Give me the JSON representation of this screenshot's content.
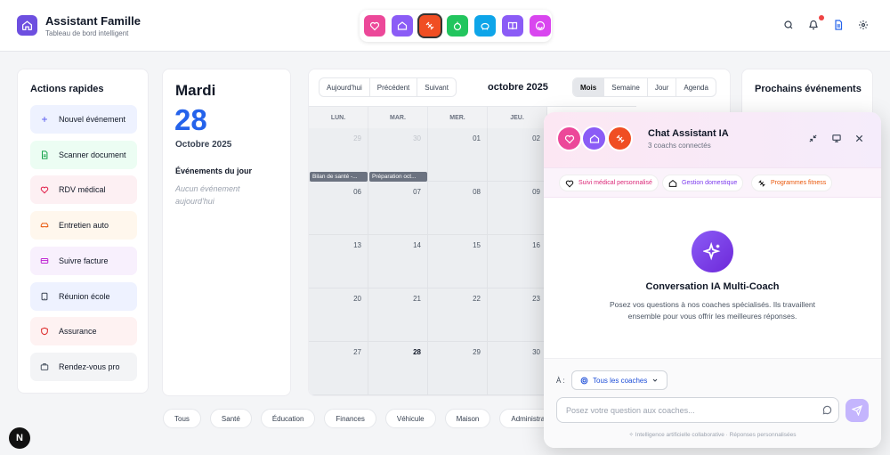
{
  "header": {
    "title": "Assistant Famille",
    "subtitle": "Tableau de bord intelligent"
  },
  "coach_bar": [
    {
      "icon": "heart-icon",
      "color": "#ec4899"
    },
    {
      "icon": "home-icon",
      "color": "#8b5cf6"
    },
    {
      "icon": "dumbbell-icon",
      "color": "#f04e23"
    },
    {
      "icon": "apple-icon",
      "color": "#22c55e"
    },
    {
      "icon": "piggy-bank-icon",
      "color": "#0ea5e9"
    },
    {
      "icon": "book-icon",
      "color": "#8b5cf6"
    },
    {
      "icon": "smile-icon",
      "color": "#d946ef"
    }
  ],
  "quick_actions": {
    "title": "Actions rapides",
    "items": [
      {
        "label": "Nouvel événement",
        "icon": "plus-icon",
        "bg": "#eef2ff",
        "color": "#6366f1"
      },
      {
        "label": "Scanner document",
        "icon": "document-icon",
        "bg": "#ecfdf3",
        "color": "#16a34a"
      },
      {
        "label": "RDV médical",
        "icon": "heart-icon",
        "bg": "#fdf0f3",
        "color": "#e11d48"
      },
      {
        "label": "Entretien auto",
        "icon": "car-icon",
        "bg": "#fff7ed",
        "color": "#ea580c"
      },
      {
        "label": "Suivre facture",
        "icon": "card-icon",
        "bg": "#f8f0fd",
        "color": "#c026d3"
      },
      {
        "label": "Réunion école",
        "icon": "tablet-icon",
        "bg": "#eef2ff",
        "color": "#374151"
      },
      {
        "label": "Assurance",
        "icon": "shield-icon",
        "bg": "#fef2f2",
        "color": "#dc2626"
      },
      {
        "label": "Rendez-vous pro",
        "icon": "briefcase-icon",
        "bg": "#f3f4f6",
        "color": "#4b5563"
      }
    ]
  },
  "day": {
    "name": "Mardi",
    "number": "28",
    "month": "Octobre 2025",
    "events_title": "Événements du jour",
    "events_empty": "Aucun événement aujourd'hui"
  },
  "calendar": {
    "nav": [
      "Aujourd'hui",
      "Précédent",
      "Suivant"
    ],
    "month": "octobre 2025",
    "views": [
      "Mois",
      "Semaine",
      "Jour",
      "Agenda"
    ],
    "active_view": "Mois",
    "days_of_week": [
      "LUN.",
      "MAR.",
      "MER.",
      "JEU."
    ],
    "weeks": [
      [
        "29",
        "30",
        "01",
        "02"
      ],
      [
        "06",
        "07",
        "08",
        "09"
      ],
      [
        "13",
        "14",
        "15",
        "16"
      ],
      [
        "20",
        "21",
        "22",
        "23"
      ],
      [
        "27",
        "28",
        "29",
        "30"
      ]
    ],
    "events": [
      "Bilan de santé -...",
      "Préparation oct..."
    ]
  },
  "next_events": {
    "title": "Prochains événements"
  },
  "categories": [
    "Tous",
    "Santé",
    "Éducation",
    "Finances",
    "Véhicule",
    "Maison",
    "Administrati"
  ],
  "chat": {
    "title": "Chat Assistant IA",
    "subtitle": "3 coachs connectés",
    "chips": [
      {
        "label": "Suivi médical personnalisé",
        "color": "#db2777"
      },
      {
        "label": "Gestion domestique",
        "color": "#7c3aed"
      },
      {
        "label": "Programmes fitness",
        "color": "#ea580c"
      }
    ],
    "conv_title": "Conversation IA Multi-Coach",
    "conv_desc": "Posez vos questions à nos coaches spécialisés. Ils travaillent ensemble pour vous offrir les meilleures réponses.",
    "to_label": "À :",
    "to_value": "Tous les coaches",
    "placeholder": "Posez votre question aux coaches...",
    "footer": "Intelligence artificielle collaborative · Réponses personnalisées"
  },
  "badge": "N"
}
